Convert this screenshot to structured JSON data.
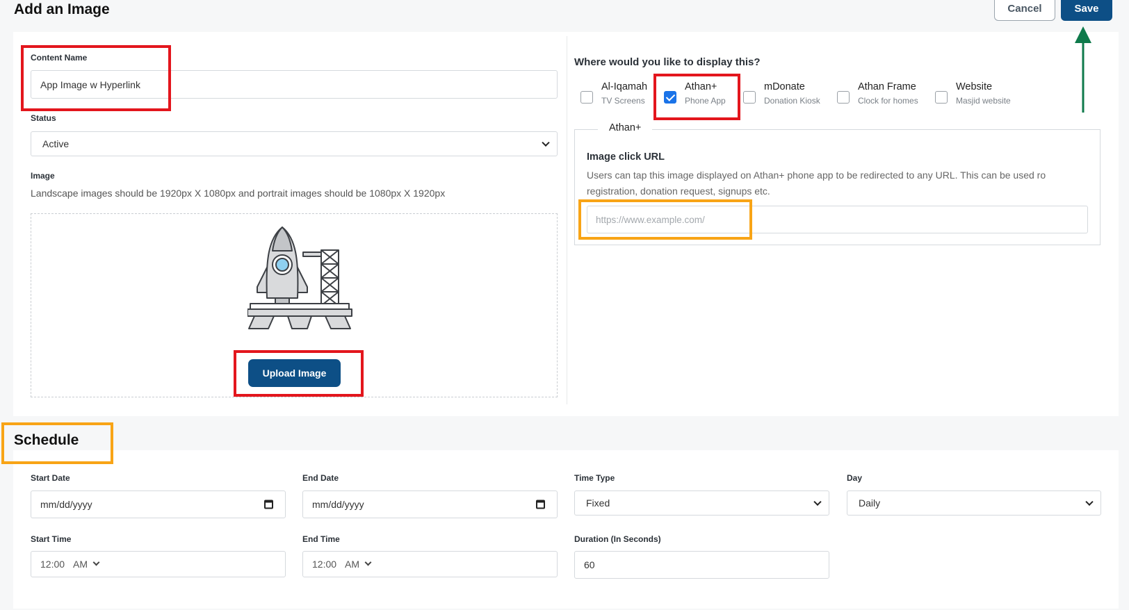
{
  "header": {
    "title": "Add an Image",
    "cancel_label": "Cancel",
    "save_label": "Save"
  },
  "content": {
    "content_name_label": "Content Name",
    "content_name_value": "App Image w Hyperlink",
    "status_label": "Status",
    "status_value": "Active",
    "image_label": "Image",
    "image_hint": "Landscape images should be 1920px X 1080px and portrait images should be 1080px X 1920px",
    "upload_label": "Upload Image"
  },
  "display": {
    "question": "Where would you like to display this?",
    "options": [
      {
        "title": "Al-Iqamah",
        "sub": "TV Screens",
        "checked": false
      },
      {
        "title": "Athan+",
        "sub": "Phone App",
        "checked": true
      },
      {
        "title": "mDonate",
        "sub": "Donation Kiosk",
        "checked": false
      },
      {
        "title": "Athan Frame",
        "sub": "Clock for homes",
        "checked": false
      },
      {
        "title": "Website",
        "sub": "Masjid website",
        "checked": false
      }
    ],
    "athan_section": {
      "legend": "Athan+",
      "url_title": "Image click URL",
      "url_desc": "Users can tap this image displayed on Athan+ phone app to be redirected to any URL. This can be used ro registration, donation request, signups etc.",
      "url_placeholder": "https://www.example.com/"
    }
  },
  "schedule": {
    "title": "Schedule",
    "start_date_label": "Start Date",
    "start_date_value": "mm/dd/yyyy",
    "end_date_label": "End Date",
    "end_date_value": "mm/dd/yyyy",
    "time_type_label": "Time Type",
    "time_type_value": "Fixed",
    "day_label": "Day",
    "day_value": "Daily",
    "start_time_label": "Start Time",
    "start_time_value": "12:00",
    "start_time_ampm": "AM",
    "end_time_label": "End Time",
    "end_time_value": "12:00",
    "end_time_ampm": "AM",
    "duration_label": "Duration (In Seconds)",
    "duration_value": "60"
  },
  "annotation_colors": {
    "red": "#e3161d",
    "orange": "#f8a416",
    "green": "#0f7a4b",
    "primary": "#0d4f86"
  }
}
